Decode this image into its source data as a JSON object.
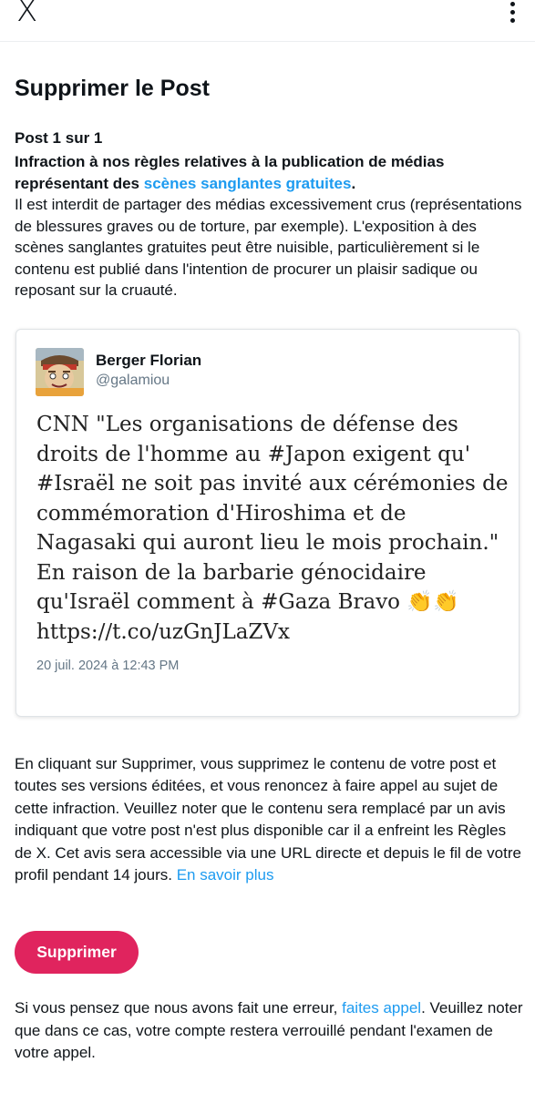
{
  "header": {
    "close_label": "X",
    "more_icon": "more-vertical-icon"
  },
  "page_title": "Supprimer le Post",
  "post_count": "Post 1 sur 1",
  "violation": {
    "heading_prefix": "Infraction à nos règles relatives à la publication de médias représentant des ",
    "heading_link": "scènes sanglantes gratuites",
    "heading_suffix": ".",
    "description": "Il est interdit de partager des médias excessivement crus (représentations de blessures graves ou de torture, par exemple). L'exposition à des scènes sanglantes gratuites peut être nuisible, particulièrement si le contenu est publié dans l'intention de procurer un plaisir sadique ou reposant sur la cruauté."
  },
  "tweet": {
    "author_name": "Berger Florian",
    "author_handle": "@galamiou",
    "text": "CNN \"Les organisations de défense des droits de l'homme au #Japon exigent qu' #Israël ne soit pas invité aux cérémonies de commémoration d'Hiroshima et de Nagasaki qui auront lieu le mois prochain.\" En raison de la barbarie génocidaire qu'Israël comment à #Gaza Bravo 👏👏 https://t.co/uzGnJLaZVx",
    "date": "20 juil. 2024 à 12:43 PM"
  },
  "explanation": {
    "text": "En cliquant sur Supprimer, vous supprimez le contenu de votre post et toutes ses versions éditées, et vous renoncez à faire appel au sujet de cette infraction. Veuillez noter que le contenu sera remplacé par un avis indiquant que votre post n'est plus disponible car il a enfreint les Règles de X. Cet avis sera accessible via une URL directe et depuis le fil de votre profil pendant 14 jours.",
    "link": "En savoir plus"
  },
  "delete_button": "Supprimer",
  "appeal": {
    "prefix": "Si vous pensez que nous avons fait une erreur, ",
    "link": "faites appel",
    "suffix": ". Veuillez noter que dans ce cas, votre compte restera verrouillé pendant l'examen de votre appel."
  },
  "colors": {
    "accent_link": "#1d9bf0",
    "delete_button": "#e0245e",
    "secondary_text": "#657786"
  }
}
